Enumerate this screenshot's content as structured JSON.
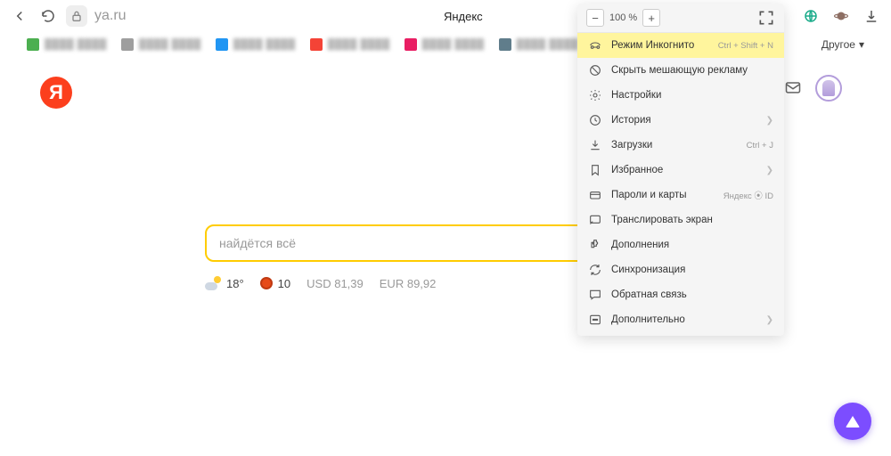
{
  "toolbar": {
    "url_host": "ya.ru",
    "page_title": "Яндекс",
    "other_label": "Другое"
  },
  "bookmarks": [
    {
      "color": "#4caf50"
    },
    {
      "color": "#9e9e9e"
    },
    {
      "color": "#2196f3"
    },
    {
      "color": "#f44336"
    },
    {
      "color": "#e91e63"
    },
    {
      "color": "#607d8b"
    },
    {
      "color": "#795548"
    }
  ],
  "menu": {
    "zoom_label": "100 %",
    "items": [
      {
        "icon": "incognito",
        "label": "Режим Инкогнито",
        "hint": "Ctrl + Shift + N",
        "hl": true
      },
      {
        "icon": "block",
        "label": "Скрыть мешающую рекламу"
      },
      {
        "icon": "gear",
        "label": "Настройки"
      },
      {
        "icon": "clock",
        "label": "История",
        "chev": true
      },
      {
        "icon": "download",
        "label": "Загрузки",
        "hint": "Ctrl + J"
      },
      {
        "icon": "bookmark",
        "label": "Избранное",
        "chev": true
      },
      {
        "icon": "cards",
        "label": "Пароли и карты",
        "hint": "Яндекс ⦿ ID"
      },
      {
        "icon": "cast",
        "label": "Транслировать экран"
      },
      {
        "icon": "puzzle",
        "label": "Дополнения"
      },
      {
        "icon": "sync",
        "label": "Синхронизация"
      },
      {
        "icon": "chat",
        "label": "Обратная связь"
      },
      {
        "icon": "more",
        "label": "Дополнительно",
        "chev": true
      }
    ]
  },
  "search": {
    "placeholder": "найдётся всё"
  },
  "info": {
    "temp": "18°",
    "traffic": "10",
    "usd_label": "USD",
    "usd_val": "81,39",
    "eur_label": "EUR",
    "eur_val": "89,92"
  }
}
